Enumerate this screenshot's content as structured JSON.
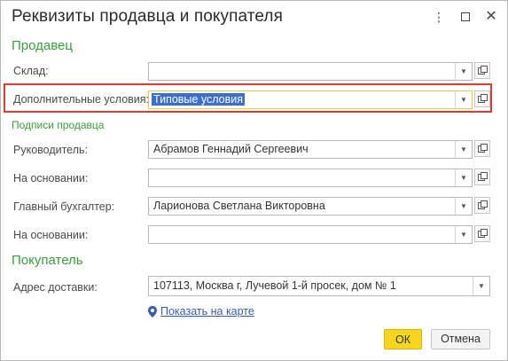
{
  "window": {
    "title": "Реквизиты продавца и покупателя",
    "menu_icon": "more-vertical-icon",
    "maximize_icon": "maximize-icon",
    "close_icon": "close-icon"
  },
  "seller": {
    "section_title": "Продавец",
    "warehouse": {
      "label": "Склад:",
      "value": ""
    },
    "additional_terms": {
      "label": "Дополнительные условия:",
      "value": "Типовые условия"
    },
    "signatures_title": "Подписи продавца",
    "director": {
      "label": "Руководитель:",
      "value": "Абрамов Геннадий Сергеевич"
    },
    "director_basis": {
      "label": "На основании:",
      "value": ""
    },
    "chief_accountant": {
      "label": "Главный бухгалтер:",
      "value": "Ларионова Светлана Викторовна"
    },
    "accountant_basis": {
      "label": "На основании:",
      "value": ""
    }
  },
  "buyer": {
    "section_title": "Покупатель",
    "delivery_address": {
      "label": "Адрес доставки:",
      "value": "107113, Москва г, Лучевой 1-й просек, дом № 1"
    },
    "map_link": "Показать на карте"
  },
  "buttons": {
    "ok": "ОК",
    "cancel": "Отмена"
  },
  "colors": {
    "section": "#3a9e3a",
    "highlight": "#e53a32",
    "ok_button": "#f6d51f",
    "link": "#3a5bb7"
  }
}
